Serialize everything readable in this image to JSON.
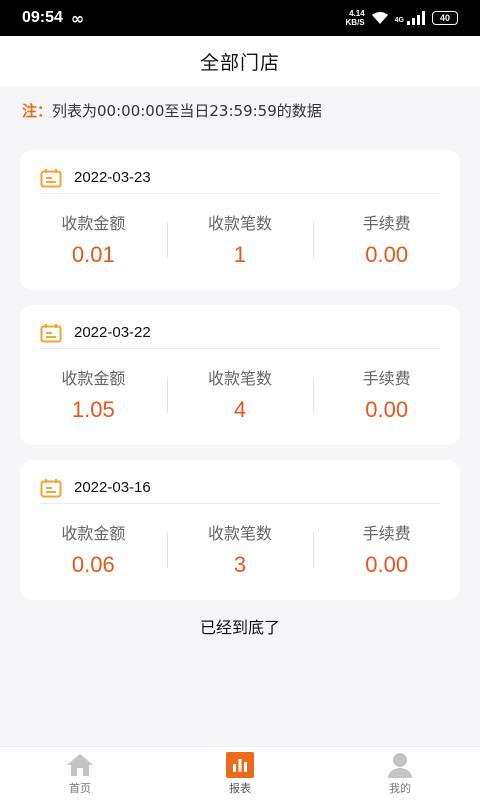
{
  "status_bar": {
    "time": "09:54",
    "net_speed_value": "4.14",
    "net_speed_unit": "KB/S",
    "network_type": "4G",
    "battery": "40"
  },
  "header": {
    "title": "全部门店"
  },
  "notice": {
    "prefix": "注：",
    "text": "列表为00:00:00至当日23:59:59的数据"
  },
  "labels": {
    "amount": "收款金额",
    "count": "收款笔数",
    "fee": "手续费"
  },
  "records": [
    {
      "date": "2022-03-23",
      "amount": "0.01",
      "count": "1",
      "fee": "0.00"
    },
    {
      "date": "2022-03-22",
      "amount": "1.05",
      "count": "4",
      "fee": "0.00"
    },
    {
      "date": "2022-03-16",
      "amount": "0.06",
      "count": "3",
      "fee": "0.00"
    }
  ],
  "end_text": "已经到底了",
  "tabs": [
    {
      "label": "首页",
      "icon": "home-icon",
      "active": false
    },
    {
      "label": "报表",
      "icon": "report-icon",
      "active": true
    },
    {
      "label": "我的",
      "icon": "profile-icon",
      "active": false
    }
  ],
  "colors": {
    "accent": "#e8561a",
    "calendar": "#f0a533",
    "active_tab": "#ec6a1c",
    "inactive_tab": "#c4c4c4"
  }
}
